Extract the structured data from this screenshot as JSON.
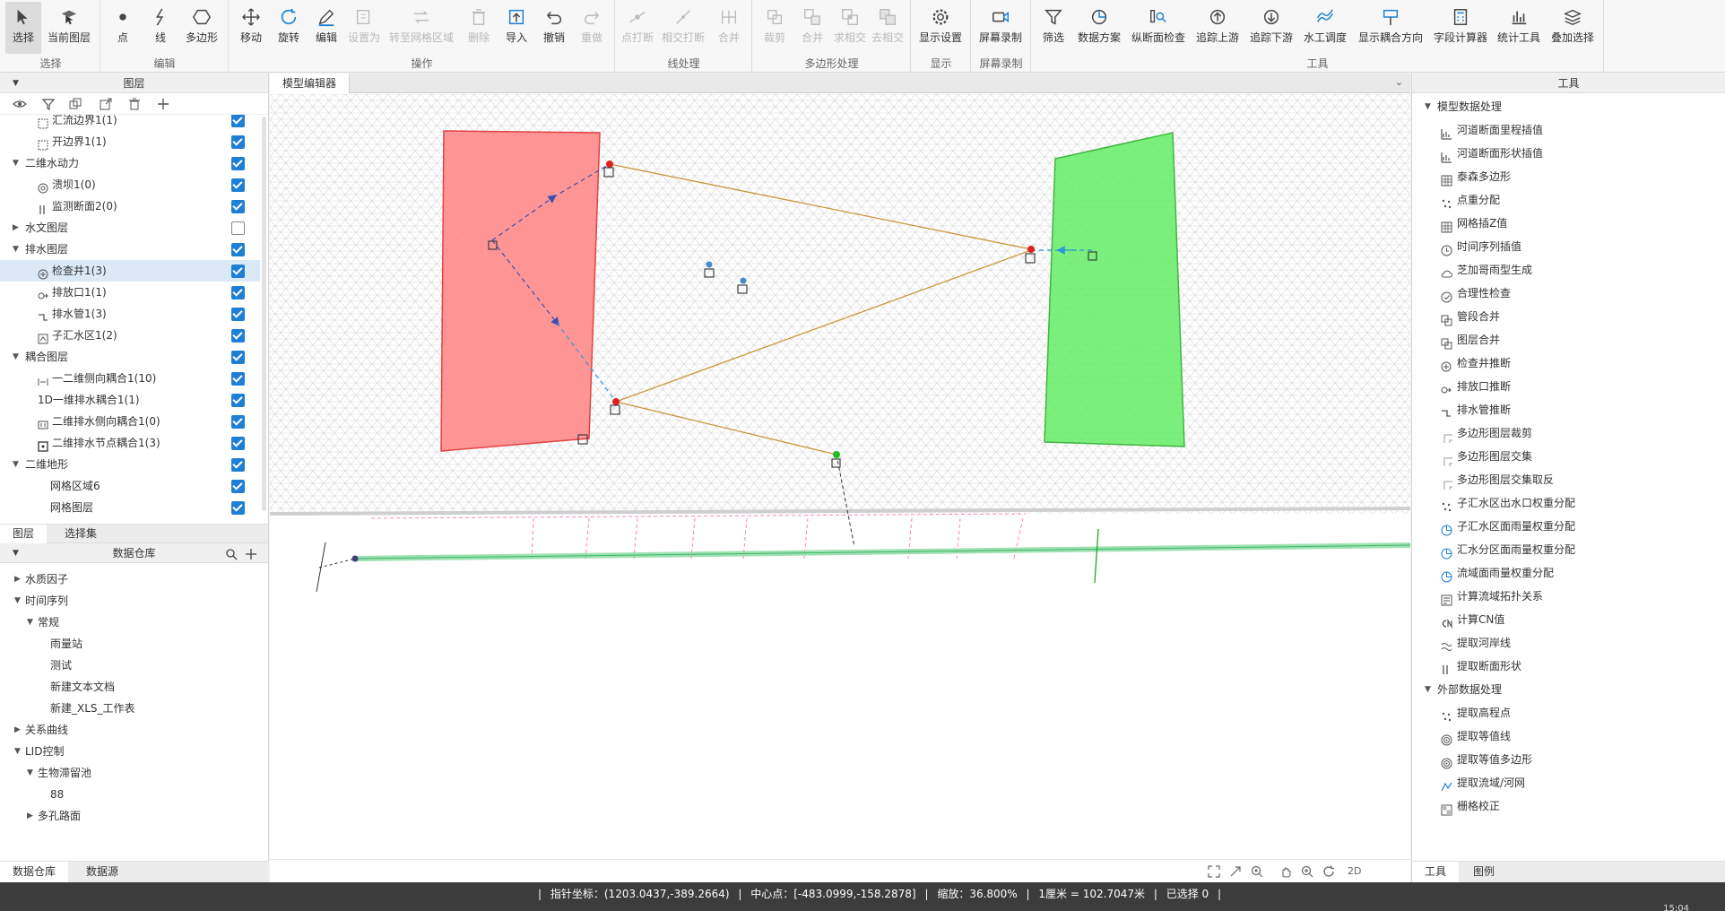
{
  "ribbon": {
    "groups": [
      {
        "label": "选择",
        "buttons": [
          {
            "label": "选择",
            "icon": "cursor-icon"
          },
          {
            "label": "当前图层",
            "icon": "layer-cursor-icon"
          }
        ]
      },
      {
        "label": "编辑",
        "buttons": [
          {
            "label": "点",
            "icon": "point-icon"
          },
          {
            "label": "线",
            "icon": "line-icon"
          },
          {
            "label": "多边形",
            "icon": "polygon-icon"
          }
        ]
      },
      {
        "label": "操作",
        "buttons": [
          {
            "label": "移动",
            "icon": "move-icon"
          },
          {
            "label": "旋转",
            "icon": "rotate-icon"
          },
          {
            "label": "编辑",
            "icon": "pencil-icon"
          },
          {
            "label": "设置为",
            "icon": "set-as-icon"
          },
          {
            "label": "转至网格区域",
            "icon": "to-grid-icon"
          },
          {
            "label": "删除",
            "icon": "delete-icon"
          },
          {
            "label": "导入",
            "icon": "import-icon"
          },
          {
            "label": "撤销",
            "icon": "undo-icon"
          },
          {
            "label": "重做",
            "icon": "redo-icon"
          }
        ]
      },
      {
        "label": "线处理",
        "buttons": [
          {
            "label": "点打断",
            "icon": "point-break-icon"
          },
          {
            "label": "相交打断",
            "icon": "intersect-break-icon"
          },
          {
            "label": "合并",
            "icon": "merge-line-icon"
          }
        ]
      },
      {
        "label": "多边形处理",
        "buttons": [
          {
            "label": "裁剪",
            "icon": "clip-icon"
          },
          {
            "label": "合并",
            "icon": "merge-polygon-icon"
          },
          {
            "label": "求相交",
            "icon": "intersect-icon"
          },
          {
            "label": "去相交",
            "icon": "remove-intersect-icon"
          }
        ]
      },
      {
        "label": "显示",
        "buttons": [
          {
            "label": "显示设置",
            "icon": "gear-icon"
          }
        ]
      },
      {
        "label": "屏幕录制",
        "buttons": [
          {
            "label": "屏幕录制",
            "icon": "video-icon"
          }
        ]
      },
      {
        "label": "工具",
        "buttons": [
          {
            "label": "筛选",
            "icon": "filter-icon"
          },
          {
            "label": "数据方案",
            "icon": "pie-icon"
          },
          {
            "label": "纵断面检查",
            "icon": "profile-check-icon"
          },
          {
            "label": "追踪上游",
            "icon": "trace-up-icon"
          },
          {
            "label": "追踪下游",
            "icon": "trace-down-icon"
          },
          {
            "label": "水工调度",
            "icon": "hydraulic-icon"
          },
          {
            "label": "显示耦合方向",
            "icon": "coupling-direction-icon"
          },
          {
            "label": "字段计算器",
            "icon": "calculator-icon"
          },
          {
            "label": "统计工具",
            "icon": "statistics-icon"
          },
          {
            "label": "叠加选择",
            "icon": "stack-icon"
          }
        ]
      }
    ]
  },
  "layers_panel": {
    "title": "图层",
    "rows": [
      {
        "label": "汇流边界1(1)",
        "level": 1,
        "expand": "",
        "icon": "boundary-icon",
        "checked": true
      },
      {
        "label": "开边界1(1)",
        "level": 1,
        "expand": "",
        "icon": "boundary-icon",
        "checked": true
      },
      {
        "label": "二维水动力",
        "level": 0,
        "expand": "▼",
        "icon": "",
        "checked": true
      },
      {
        "label": "溃坝1(0)",
        "level": 1,
        "expand": "",
        "icon": "dam-icon",
        "checked": true
      },
      {
        "label": "监测断面2(0)",
        "level": 1,
        "expand": "",
        "icon": "section-icon",
        "checked": true
      },
      {
        "label": "水文图层",
        "level": 0,
        "expand": "▶",
        "icon": "",
        "checked": false
      },
      {
        "label": "排水图层",
        "level": 0,
        "expand": "▼",
        "icon": "",
        "checked": true
      },
      {
        "label": "检查井1(3)",
        "level": 1,
        "expand": "",
        "icon": "manhole-icon",
        "checked": true,
        "selected": true
      },
      {
        "label": "排放口1(1)",
        "level": 1,
        "expand": "",
        "icon": "outfall-icon",
        "checked": true
      },
      {
        "label": "排水管1(3)",
        "level": 1,
        "expand": "",
        "icon": "pipe-icon",
        "checked": true
      },
      {
        "label": "子汇水区1(2)",
        "level": 1,
        "expand": "",
        "icon": "subcatchment-icon",
        "checked": true
      },
      {
        "label": "耦合图层",
        "level": 0,
        "expand": "▼",
        "icon": "",
        "checked": true
      },
      {
        "label": "一二维侧向耦合1(10)",
        "level": 1,
        "expand": "",
        "icon": "lateral-coupling-icon",
        "checked": true
      },
      {
        "label": "1D一维排水耦合1(1)",
        "level": 1,
        "expand": "",
        "icon": "",
        "checked": true
      },
      {
        "label": "二维排水侧向耦合1(0)",
        "level": 1,
        "expand": "",
        "icon": "drain-coupling-icon",
        "checked": true
      },
      {
        "label": "二维排水节点耦合1(3)",
        "level": 1,
        "expand": "",
        "icon": "node-coupling-icon",
        "checked": true
      },
      {
        "label": "二维地形",
        "level": 0,
        "expand": "▼",
        "icon": "",
        "checked": true
      },
      {
        "label": "网格区域6",
        "level": 2,
        "expand": "",
        "icon": "",
        "checked": true
      },
      {
        "label": "网格图层",
        "level": 2,
        "expand": "",
        "icon": "",
        "checked": true
      }
    ],
    "tabs": [
      "图层",
      "选择集"
    ]
  },
  "repository": {
    "title": "数据仓库",
    "rows": [
      {
        "label": "水质因子",
        "level": 0,
        "expand": "▶"
      },
      {
        "label": "时间序列",
        "level": 0,
        "expand": "▼"
      },
      {
        "label": "常规",
        "level": 1,
        "expand": "▼"
      },
      {
        "label": "雨量站",
        "level": 2,
        "expand": ""
      },
      {
        "label": "测试",
        "level": 2,
        "expand": ""
      },
      {
        "label": "新建文本文档",
        "level": 2,
        "expand": ""
      },
      {
        "label": "新建_XLS_工作表",
        "level": 2,
        "expand": ""
      },
      {
        "label": "关系曲线",
        "level": 0,
        "expand": "▶"
      },
      {
        "label": "LID控制",
        "level": 0,
        "expand": "▼"
      },
      {
        "label": "生物滞留池",
        "level": 1,
        "expand": "▼"
      },
      {
        "label": "88",
        "level": 2,
        "expand": ""
      },
      {
        "label": "多孔路面",
        "level": 1,
        "expand": "▶"
      }
    ],
    "bottom_tabs": [
      "数据仓库",
      "数据源"
    ]
  },
  "editor": {
    "tab": "模型编辑器",
    "map_tools": [
      "extent-icon",
      "zoom-extent-icon",
      "zoom-select-icon",
      "pan-icon",
      "zoom-in-icon",
      "refresh-icon"
    ],
    "view_mode": "2D"
  },
  "tools_panel": {
    "title": "工具",
    "sections": [
      {
        "label": "模型数据处理",
        "items": [
          {
            "label": "河道断面里程插值",
            "icon": "chart-icon"
          },
          {
            "label": "河道断面形状插值",
            "icon": "chart-icon"
          },
          {
            "label": "泰森多边形",
            "icon": "grid-icon"
          },
          {
            "label": "点重分配",
            "icon": "dots-icon"
          },
          {
            "label": "网格插Z值",
            "icon": "grid-icon"
          },
          {
            "label": "时间序列插值",
            "icon": "clock-icon"
          },
          {
            "label": "芝加哥雨型生成",
            "icon": "cloud-icon"
          },
          {
            "label": "合理性检查",
            "icon": "check-icon"
          },
          {
            "label": "管段合并",
            "icon": "merge-icon"
          },
          {
            "label": "图层合并",
            "icon": "merge-icon"
          },
          {
            "label": "检查井推断",
            "icon": "manhole-icon"
          },
          {
            "label": "排放口推断",
            "icon": "outfall-icon"
          },
          {
            "label": "排水管推断",
            "icon": "pipe-icon"
          },
          {
            "label": "多边形图层裁剪",
            "icon": "clip-icon"
          },
          {
            "label": "多边形图层交集",
            "icon": "clip-icon"
          },
          {
            "label": "多边形图层交集取反",
            "icon": "clip-icon"
          },
          {
            "label": "子汇水区出水口权重分配",
            "icon": "dots-icon"
          },
          {
            "label": "子汇水区面雨量权重分配",
            "icon": "weight-icon"
          },
          {
            "label": "汇水分区面雨量权重分配",
            "icon": "weight-icon"
          },
          {
            "label": "流域面雨量权重分配",
            "icon": "weight-icon"
          },
          {
            "label": "计算流域拓扑关系",
            "icon": "topology-icon"
          },
          {
            "label": "计算CN值",
            "icon": "cn-icon"
          },
          {
            "label": "提取河岸线",
            "icon": "bank-icon"
          },
          {
            "label": "提取断面形状",
            "icon": "section-icon"
          }
        ]
      },
      {
        "label": "外部数据处理",
        "items": [
          {
            "label": "提取高程点",
            "icon": "dots-icon"
          },
          {
            "label": "提取等值线",
            "icon": "contour-icon"
          },
          {
            "label": "提取等值多边形",
            "icon": "contour-icon"
          },
          {
            "label": "提取流域/河网",
            "icon": "basin-icon"
          },
          {
            "label": "栅格校正",
            "icon": "raster-icon"
          }
        ]
      }
    ],
    "bottom_tabs": [
      "工具",
      "图例"
    ]
  },
  "status": {
    "pointer": "指针坐标：(1203.0437,-389.2664)",
    "center": "中心点：[-483.0999,-158.2878]",
    "zoom": "缩放：36.800%",
    "scale": "1厘米 = 102.7047米",
    "selected": "已选择 0",
    "clock": "15:04"
  },
  "colors": {
    "accent": "#1e7fd6",
    "red_zone": "#ff8a8a",
    "green_zone": "#66ee66",
    "pipe": "#c9963c",
    "coupling": "#3a4fb0"
  }
}
